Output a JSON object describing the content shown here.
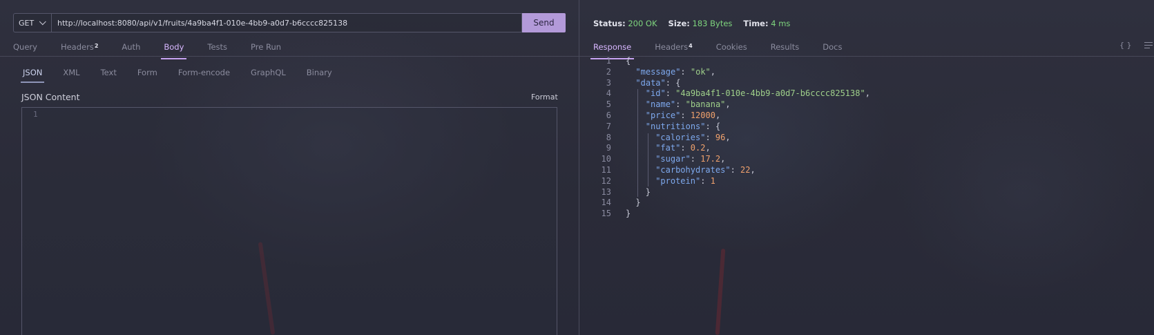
{
  "request": {
    "method": "GET",
    "url": "http://localhost:8080/api/v1/fruits/4a9ba4f1-010e-4bb9-a0d7-b6cccc825138",
    "send_label": "Send",
    "tabs": [
      {
        "label": "Query",
        "badge": ""
      },
      {
        "label": "Headers",
        "badge": "2"
      },
      {
        "label": "Auth",
        "badge": ""
      },
      {
        "label": "Body",
        "badge": "",
        "active": true
      },
      {
        "label": "Tests",
        "badge": ""
      },
      {
        "label": "Pre Run",
        "badge": ""
      }
    ],
    "body_types": [
      "JSON",
      "XML",
      "Text",
      "Form",
      "Form-encode",
      "GraphQL",
      "Binary"
    ],
    "body_active": "JSON",
    "json_content_label": "JSON Content",
    "format_label": "Format",
    "editor_line": "1"
  },
  "response": {
    "status_label": "Status:",
    "status_value": "200 OK",
    "size_label": "Size:",
    "size_value": "183 Bytes",
    "time_label": "Time:",
    "time_value": "4 ms",
    "tabs": [
      {
        "label": "Response",
        "badge": "",
        "active": true
      },
      {
        "label": "Headers",
        "badge": "4"
      },
      {
        "label": "Cookies",
        "badge": ""
      },
      {
        "label": "Results",
        "badge": ""
      },
      {
        "label": "Docs",
        "badge": ""
      }
    ],
    "braces_icon": "{ }",
    "body": {
      "message": "ok",
      "data": {
        "id": "4a9ba4f1-010e-4bb9-a0d7-b6cccc825138",
        "name": "banana",
        "price": 12000,
        "nutritions": {
          "calories": 96,
          "fat": 0.2,
          "sugar": 17.2,
          "carbohydrates": 22,
          "protein": 1
        }
      }
    }
  },
  "colors": {
    "accent": "#b39ad9",
    "active_tab": "#d8b7ff",
    "status_ok": "#7ed57e",
    "json_key": "#7ea9ee",
    "json_string": "#9fd08a",
    "json_number": "#f1a26d"
  }
}
